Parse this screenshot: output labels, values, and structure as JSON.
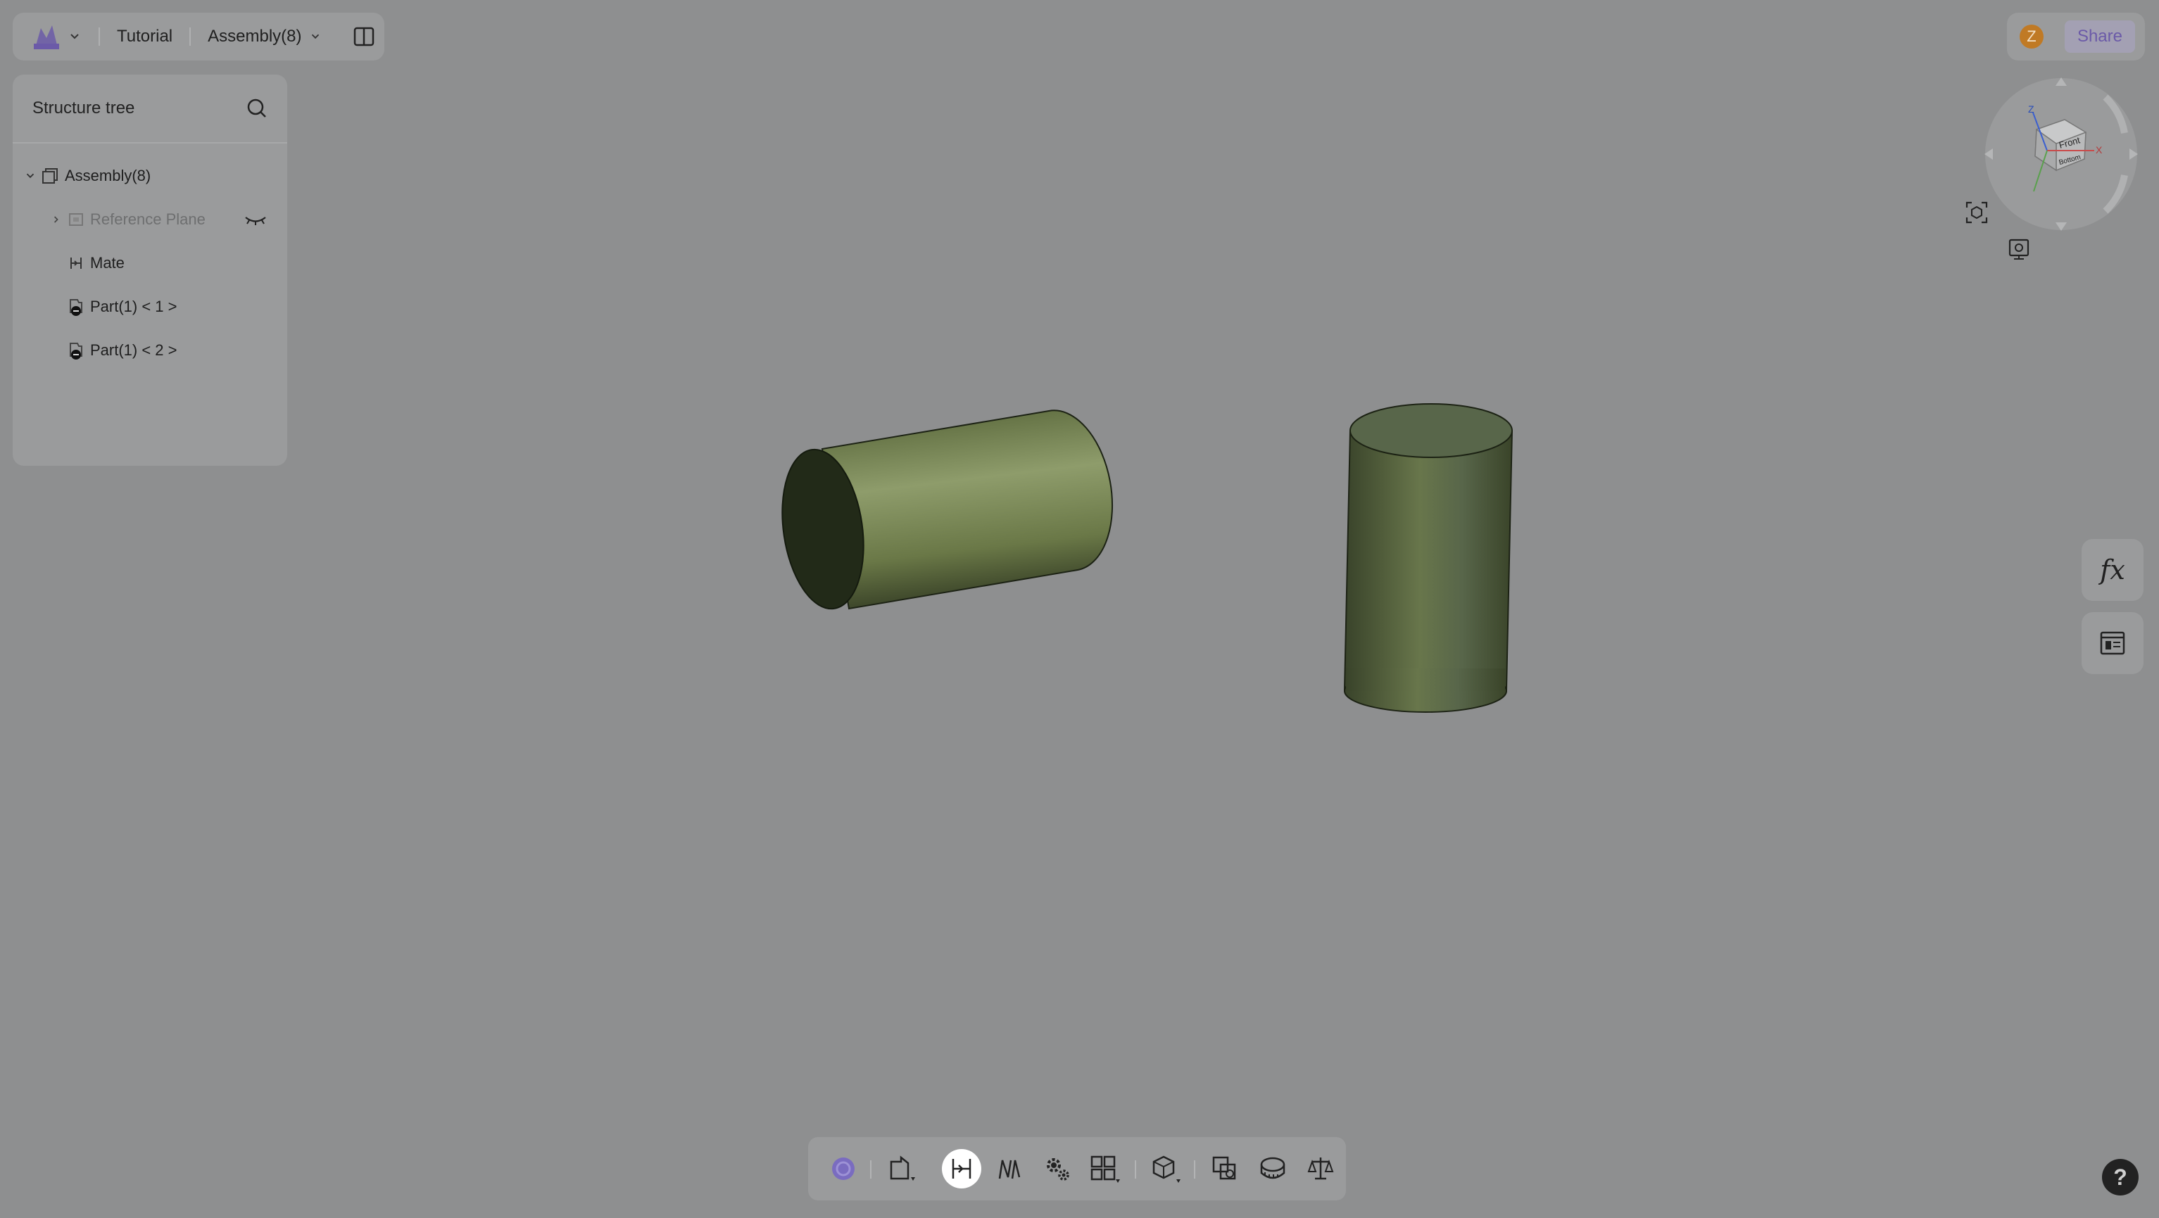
{
  "header": {
    "project": "Tutorial",
    "document": "Assembly(8)"
  },
  "tree": {
    "title": "Structure tree",
    "items": [
      {
        "label": "Assembly(8)"
      },
      {
        "label": "Reference Plane"
      },
      {
        "label": "Mate"
      },
      {
        "label": "Part(1) < 1 >"
      },
      {
        "label": "Part(1) < 2 >"
      }
    ]
  },
  "account": {
    "avatar_letter": "Z",
    "share_label": "Share"
  },
  "viewcube": {
    "faces": [
      "Front",
      "Bottom"
    ],
    "axes": [
      "Z",
      "X"
    ]
  },
  "side_tools": {
    "formula_label": "fx"
  },
  "toolbar": {
    "items": [
      {
        "icon": "orbit-icon"
      },
      {
        "icon": "insert-part-icon"
      },
      {
        "icon": "mate-icon",
        "active": true
      },
      {
        "icon": "mate-references-icon"
      },
      {
        "icon": "gear-icon"
      },
      {
        "icon": "pattern-icon"
      },
      {
        "icon": "explode-view-icon"
      },
      {
        "icon": "interference-icon"
      },
      {
        "icon": "measure-icon"
      },
      {
        "icon": "mass-properties-icon"
      }
    ]
  },
  "help_label": "?",
  "colors": {
    "background": "#8e8f90",
    "panel": "#9a9b9c",
    "part_fill": "#6b7a4a",
    "accent": "#6b5aa8"
  }
}
